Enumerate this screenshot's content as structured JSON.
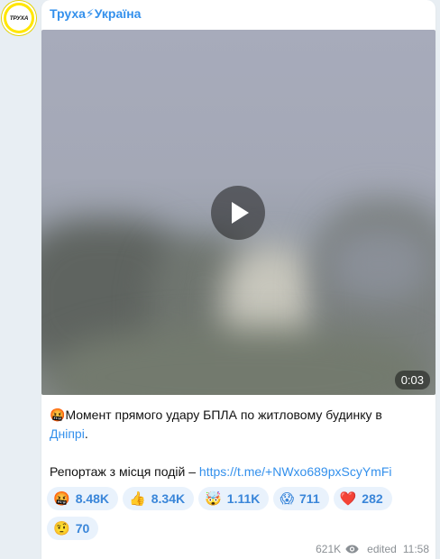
{
  "channel": {
    "name": "Труха⚡Україна",
    "avatar_text": "ТРУХА",
    "accent": "#3390ec"
  },
  "media": {
    "duration": "0:03",
    "play_icon": "play-icon"
  },
  "post": {
    "line1_emoji": "🤬",
    "line1_text": "Момент прямого удару БПЛА по житловому будинку в",
    "line2_link": "Дніпрі",
    "line2_suffix": ".",
    "line3_text": "Репортаж з місця подій – ",
    "line3_link": "https://t.me/+NWxo689pxScyYmFi"
  },
  "reactions": [
    {
      "emoji": "🤬",
      "count": "8.48K"
    },
    {
      "emoji": "👍",
      "count": "8.34K"
    },
    {
      "emoji": "🤯",
      "count": "1.11K"
    },
    {
      "emoji": "😱",
      "count": "711"
    },
    {
      "emoji": "❤️",
      "count": "282"
    },
    {
      "emoji": "🤨",
      "count": "70"
    }
  ],
  "meta": {
    "views": "621K",
    "edited": "edited",
    "time": "11:58"
  }
}
